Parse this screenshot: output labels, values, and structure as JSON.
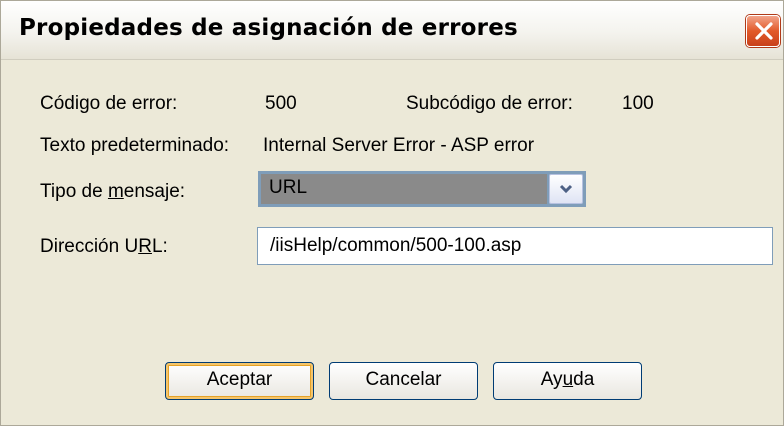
{
  "window": {
    "title": "Propiedades de asignación de errores",
    "close_icon": "close-icon"
  },
  "fields": {
    "error_code_label": "Código de error:",
    "error_code_value": "500",
    "subcode_label": "Subcódigo de error:",
    "subcode_value": "100",
    "default_text_label": "Texto predeterminado:",
    "default_text_value": "Internal Server Error - ASP error",
    "message_type_label": {
      "pre": "Tipo de ",
      "underlined": "m",
      "post": "ensaje:"
    },
    "message_type_value": "URL",
    "url_label": {
      "pre": "Dirección U",
      "underlined": "R",
      "post": "L:"
    },
    "url_value": "/iisHelp/common/500-100.asp"
  },
  "buttons": {
    "ok": "Aceptar",
    "cancel": "Cancelar",
    "help": {
      "pre": "Ay",
      "underlined": "u",
      "post": "da"
    }
  }
}
